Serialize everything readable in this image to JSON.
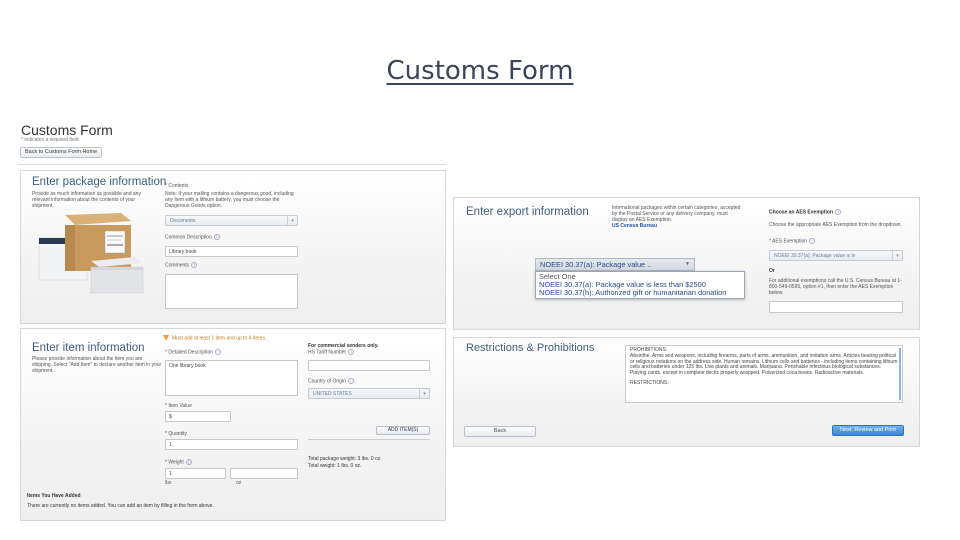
{
  "slide": {
    "title": "Customs Form"
  },
  "left": {
    "page_title": "Customs Form",
    "required_note": "* indicates a required field",
    "back_portal_button": "Back to Customs Form Home",
    "package_section": {
      "title": "Enter package information",
      "description": "Provide as much information as possible and any relevant information about the contents of your shipment.",
      "contents_label": "* Contents",
      "contents_note": "Note: If your mailing contains a dangerous good, including any item with a lithium battery, you must choose the Dangerous Goods option.",
      "contents_value": "Documents",
      "common_description_label": "Common Description",
      "common_description_value": "Library book",
      "comments_label": "Comments",
      "comments_value": ""
    },
    "item_section": {
      "title": "Enter item information",
      "description": "Please provide information about the item you are shipping. Select \"Add Item\" to declare another item in your shipment.",
      "warning": "Must add at least 1 item and up to 4 items.",
      "detailed_description_label": "* Detailed Description",
      "detailed_description_value": "One library book",
      "commercial_note": "For commercial senders only.",
      "hs_tariff_label": "HS Tariff Number",
      "hs_tariff_value": "",
      "country_origin_label": "Country of Origin",
      "country_origin_value": "UNITED STATES",
      "item_value_label": "* Item Value",
      "item_value_value": "$",
      "quantity_label": "* Quantity",
      "quantity_value": "1",
      "weight_label": "* Weight",
      "weight_lbs_value": "1",
      "weight_oz_value": "",
      "weight_lbs_unit": "lbs",
      "weight_oz_unit": "oz",
      "add_item_button": "ADD ITEM(S)",
      "total_package_weight": "Total package weight: 3 lbs. 0 oz.",
      "total_weight": "Total weight: 1 lbs. 0 oz."
    },
    "items_added": {
      "title": "Items You Have Added",
      "empty_text": "There are currently no items added. You can add an item by filling in the form above."
    }
  },
  "right": {
    "export_section": {
      "title": "Enter export information",
      "description": "International packages within certain categories, accepted by the Postal Service or any delivery company, must display an AES Exemption.",
      "census_link": "US Census Bureau",
      "dropdown_selected": "NOEEI 30.37(a): Package value ..",
      "dropdown_options": [
        "Select One",
        "NOEEI 30.37(a): Package value is less than $2500",
        "NOEEI 30.37(h): Authorized gift or humanitarian donation"
      ],
      "choose_aes_label": "Choose an AES Exemption",
      "choose_aes_desc": "Choose the appropriate AES Exemption from the dropdown.",
      "aes_exemption_label": "* AES Exemption",
      "aes_exemption_value": "NOEEI 30.37(a): Package value is le",
      "or_label": "Or",
      "additional_note": "For additional exemptions call the U.S. Census Bureau at 1-800-549-0595, option #1, then enter the AES Exemption below.",
      "aes_input_value": ""
    },
    "restrictions_section": {
      "title": "Restrictions & Prohibitions",
      "prohibitions_heading": "PROHIBITIONS:",
      "prohibitions_text": "Absinthe. Arms and weapons, including firearms, parts of arms, ammunition, and imitation arms. Articles bearing political or religious notations on the address side. Human remains. Lithium cells and batteries - including items containing lithium cells and batteries under 125 lbs. Live plants and animals. Marijuana. Perishable infectious biological substances. Playing cards, except in complete decks properly wrapped. Pulverized coca beans. Radioactive materials.",
      "restrictions_heading": "RESTRICTIONS:"
    },
    "back_button": "Back",
    "next_button": "Next: Review and Print"
  }
}
